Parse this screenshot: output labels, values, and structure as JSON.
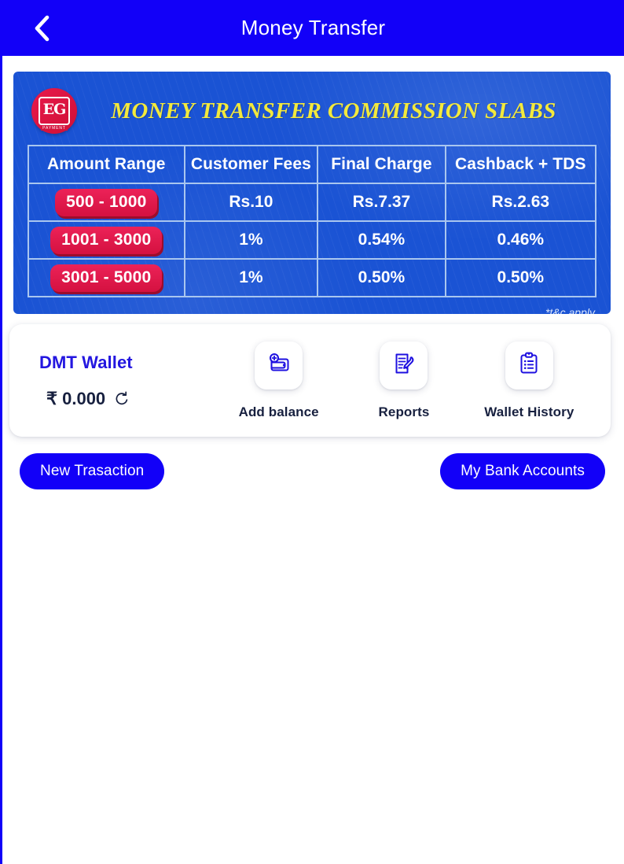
{
  "header": {
    "title": "Money Transfer",
    "back_icon": "chevron-left-icon"
  },
  "banner": {
    "title": "MONEY TRANSFER COMMISSION SLABS",
    "logo": {
      "mark": "EG",
      "sub": "PAYMENT"
    },
    "table": {
      "columns": [
        "Amount Range",
        "Customer Fees",
        "Final Charge",
        "Cashback + TDS"
      ],
      "rows": [
        {
          "range": "500 - 1000",
          "customer_fees": "Rs.10",
          "final_charge": "Rs.7.37",
          "cashback_tds": "Rs.2.63"
        },
        {
          "range": "1001 - 3000",
          "customer_fees": "1%",
          "final_charge": "0.54%",
          "cashback_tds": "0.46%"
        },
        {
          "range": "3001 - 5000",
          "customer_fees": "1%",
          "final_charge": "0.50%",
          "cashback_tds": "0.50%"
        }
      ]
    },
    "footnote": "*t&c apply",
    "colors": {
      "background": "#1a53d4",
      "title": "#f3e93c",
      "pill": "#e31b4f",
      "border": "#a9c6ef"
    }
  },
  "wallet": {
    "name": "DMT Wallet",
    "balance": "₹ 0.000",
    "refresh_icon": "refresh-icon",
    "actions": [
      {
        "label": "Add balance",
        "icon": "wallet-plus-icon"
      },
      {
        "label": "Reports",
        "icon": "document-pen-icon"
      },
      {
        "label": "Wallet History",
        "icon": "clipboard-list-icon"
      }
    ]
  },
  "buttons": {
    "new_transaction": "New Trasaction",
    "my_bank_accounts": "My Bank Accounts"
  },
  "colors": {
    "primary": "#1200f8",
    "accent_blue": "#2316e0",
    "text_dark": "#17203f",
    "page_bg": "#ffffff"
  }
}
